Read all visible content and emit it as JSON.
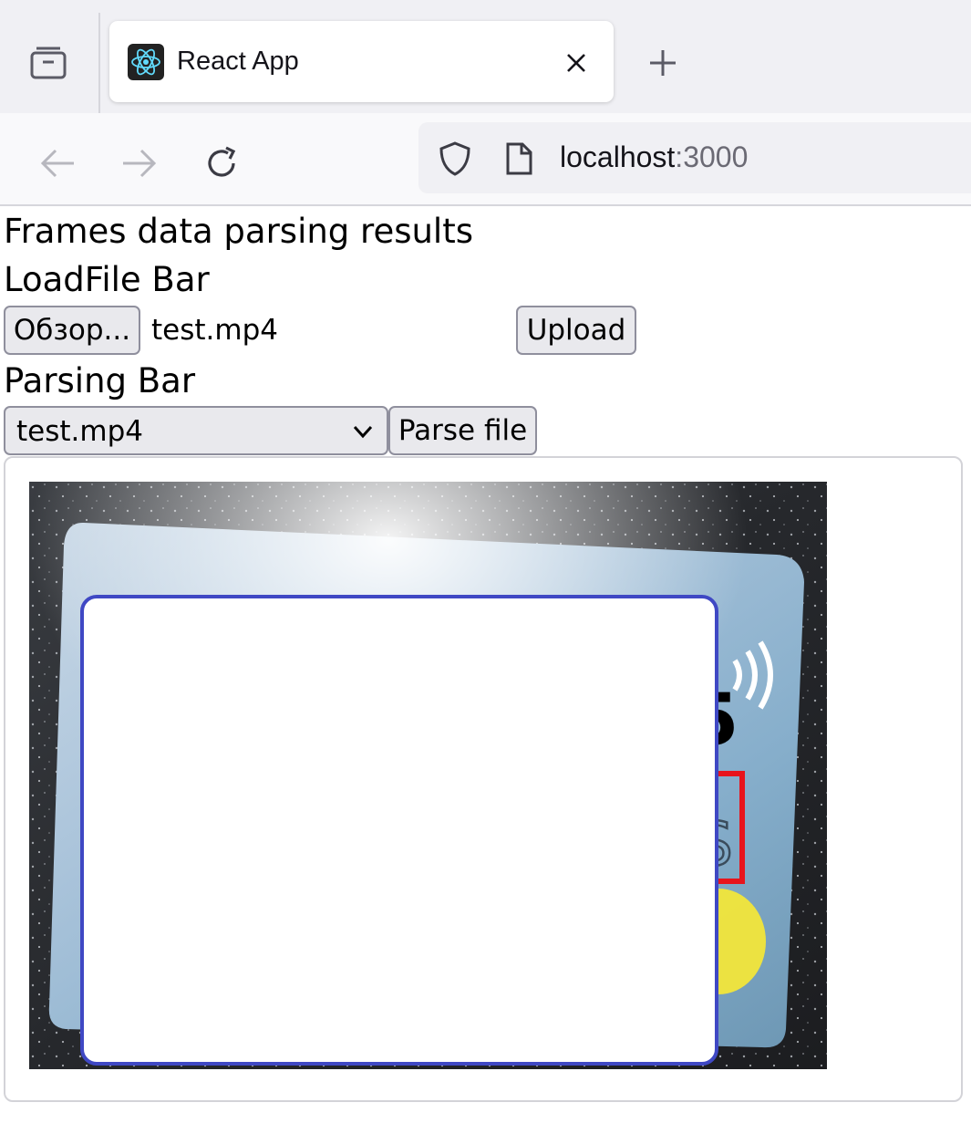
{
  "browser": {
    "tab": {
      "title": "React App"
    },
    "url": {
      "host": "localhost",
      "port": ":3000"
    }
  },
  "page": {
    "title": "Frames data parsing results",
    "loadfile": {
      "heading": "LoadFile Bar",
      "browse_label": "Обзор...",
      "file_name": "test.mp4",
      "upload_label": "Upload"
    },
    "parsing": {
      "heading": "Parsing Bar",
      "selected_file": "test.mp4",
      "parse_label": "Parse file"
    }
  },
  "frame": {
    "card_glyph_digit": "5",
    "card_glyph_letter": "S",
    "colors": {
      "overlay_border": "#3f48c4",
      "detection_box": "#e8141c",
      "chip": "#f2e63a"
    }
  },
  "icons": [
    "tab-list-icon",
    "react-logo-icon",
    "close-icon",
    "plus-icon",
    "back-arrow-icon",
    "forward-arrow-icon",
    "reload-icon",
    "shield-icon",
    "page-icon",
    "chevron-down-icon"
  ]
}
